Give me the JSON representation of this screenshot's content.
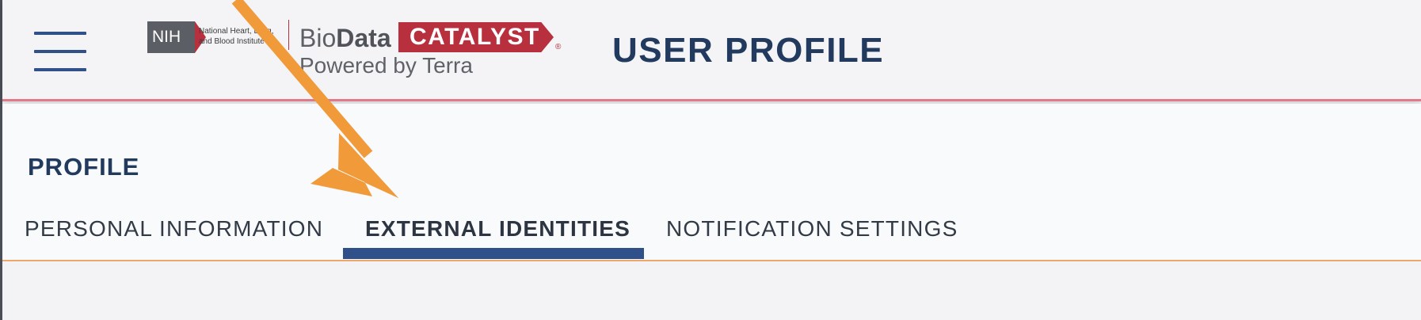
{
  "header": {
    "nih_label": "NIH",
    "nih_institute_line1": "National Heart, Lung,",
    "nih_institute_line2": "and Blood Institute",
    "brand_bio": "Bio",
    "brand_data": "Data",
    "brand_catalyst": "CATALYST",
    "brand_registered": "®",
    "brand_powered": "Powered by Terra",
    "page_title": "USER PROFILE"
  },
  "profile": {
    "section_title": "PROFILE",
    "tabs": [
      {
        "label": "PERSONAL INFORMATION",
        "active": false
      },
      {
        "label": "EXTERNAL IDENTITIES",
        "active": true
      },
      {
        "label": "NOTIFICATION SETTINGS",
        "active": false
      }
    ]
  },
  "colors": {
    "primary_navy": "#213a5e",
    "tab_active_underline": "#2f5088",
    "brand_red": "#b8303d",
    "annotation_arrow": "#f09a3a",
    "divider_orange": "#eda76a"
  },
  "icons": {
    "menu": "hamburger-menu-icon",
    "annotation": "arrow-annotation"
  }
}
